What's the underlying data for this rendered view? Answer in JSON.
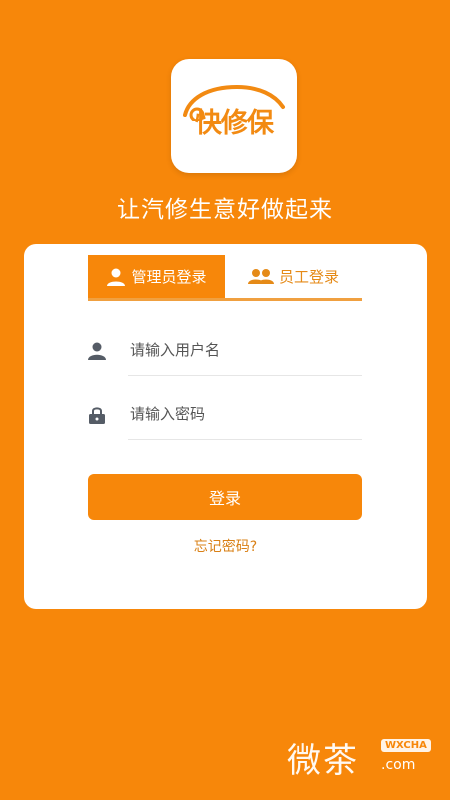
{
  "logo": {
    "text": "快修保"
  },
  "tagline": "让汽修生意好做起来",
  "tabs": [
    {
      "label": "管理员登录",
      "icon": "user-icon",
      "active": true
    },
    {
      "label": "员工登录",
      "icon": "users-icon",
      "active": false
    }
  ],
  "form": {
    "username_placeholder": "请输入用户名",
    "password_placeholder": "请输入密码",
    "login_label": "登录",
    "forgot_label": "忘记密码?"
  },
  "watermark": {
    "text": "微茶",
    "badge": "WXCHA",
    "domain": ".com"
  },
  "colors": {
    "primary": "#F7870A",
    "card": "#FFFFFF",
    "accent_text": "#E58A17"
  }
}
